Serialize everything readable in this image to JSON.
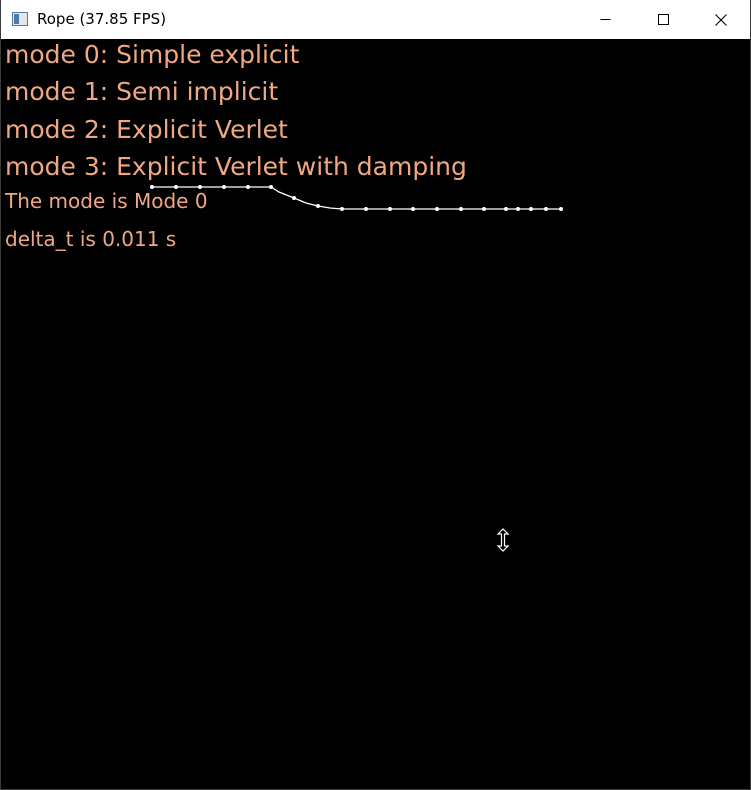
{
  "window": {
    "title": "Rope (37.85 FPS)",
    "minimize_icon": "minimize-icon",
    "maximize_icon": "maximize-icon",
    "close_icon": "close-icon"
  },
  "hud": {
    "mode0": "mode 0: Simple explicit",
    "mode1": "mode 1: Semi implicit",
    "mode2": "mode 2: Explicit Verlet",
    "mode3": "mode 3: Explicit Verlet with damping",
    "current_mode": "The mode is Mode 0",
    "delta_t": "delta_t is 0.011 s"
  },
  "colors": {
    "hud_text": "#f0a882",
    "background": "#000000",
    "rope": "#ffffff"
  },
  "cursor": "vertical-resize-cursor-icon"
}
